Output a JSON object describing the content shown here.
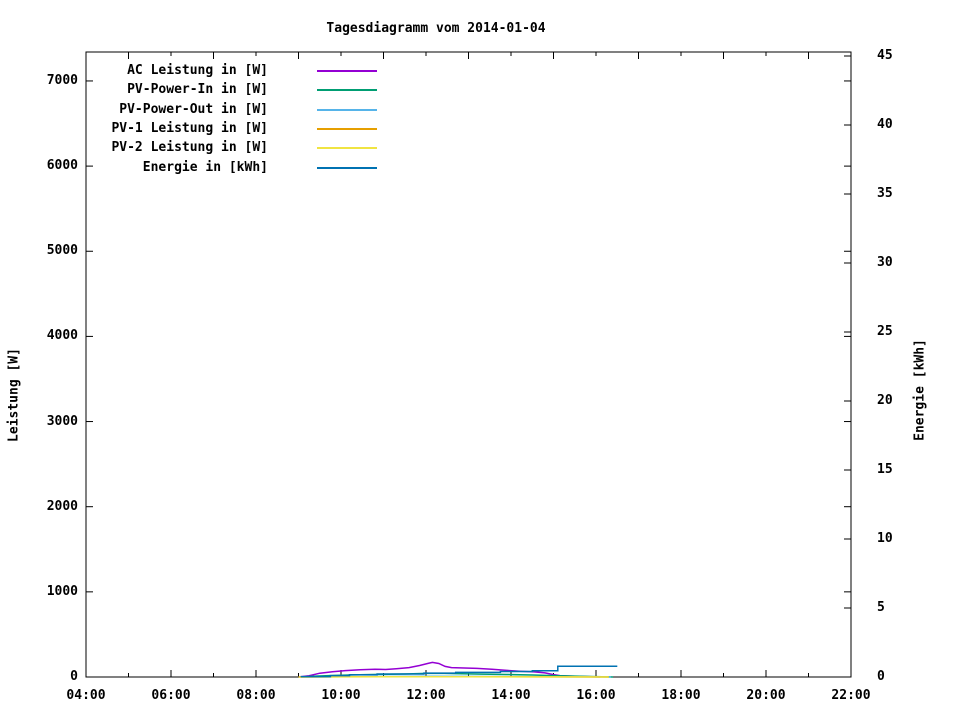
{
  "chart_data": {
    "type": "line",
    "title": "Tagesdiagramm vom 2014-01-04",
    "xlabel": "",
    "x_axis": {
      "range_hours": [
        4,
        22
      ],
      "major_tick_hours": [
        4,
        6,
        8,
        10,
        12,
        14,
        16,
        18,
        20,
        22
      ],
      "minor_tick_hours": [
        5,
        7,
        9,
        11,
        13,
        15,
        17,
        19,
        21
      ],
      "tick_labels": [
        "04:00",
        "06:00",
        "08:00",
        "10:00",
        "12:00",
        "14:00",
        "16:00",
        "18:00",
        "20:00",
        "22:00"
      ]
    },
    "y_left": {
      "label": "Leistung [W]",
      "range": [
        0,
        7340
      ],
      "ticks": [
        0,
        1000,
        2000,
        3000,
        4000,
        5000,
        6000,
        7000
      ]
    },
    "y_right": {
      "label": "Energie [kWh]",
      "range": [
        0,
        45.3
      ],
      "ticks": [
        0,
        5,
        10,
        15,
        20,
        25,
        30,
        35,
        40,
        45
      ]
    },
    "grid": "off",
    "legend_position": "top-left-inside",
    "series": [
      {
        "name": "AC Leistung in [W]",
        "color": "#9400d3",
        "axis": "left",
        "step": false,
        "points": [
          [
            9.0,
            0
          ],
          [
            9.25,
            15
          ],
          [
            9.5,
            45
          ],
          [
            9.8,
            62
          ],
          [
            10.1,
            75
          ],
          [
            10.45,
            85
          ],
          [
            10.8,
            92
          ],
          [
            11.05,
            88
          ],
          [
            11.3,
            97
          ],
          [
            11.6,
            110
          ],
          [
            11.85,
            135
          ],
          [
            12.05,
            160
          ],
          [
            12.15,
            172
          ],
          [
            12.3,
            158
          ],
          [
            12.45,
            125
          ],
          [
            12.6,
            110
          ],
          [
            12.9,
            106
          ],
          [
            13.2,
            101
          ],
          [
            13.55,
            92
          ],
          [
            13.9,
            78
          ],
          [
            14.2,
            68
          ],
          [
            14.55,
            60
          ],
          [
            14.8,
            48
          ],
          [
            15.0,
            28
          ],
          [
            15.15,
            16
          ],
          [
            15.4,
            10
          ],
          [
            15.7,
            6
          ],
          [
            16.1,
            0
          ]
        ]
      },
      {
        "name": "PV-Power-In in [W]",
        "color": "#009e73",
        "axis": "left",
        "step": false,
        "points": [
          [
            9.05,
            0
          ],
          [
            9.4,
            10
          ],
          [
            9.8,
            18
          ],
          [
            10.3,
            25
          ],
          [
            10.9,
            30
          ],
          [
            11.5,
            35
          ],
          [
            12.0,
            42
          ],
          [
            12.3,
            45
          ],
          [
            12.7,
            40
          ],
          [
            13.3,
            34
          ],
          [
            13.9,
            29
          ],
          [
            14.5,
            24
          ],
          [
            15.0,
            17
          ],
          [
            15.5,
            10
          ],
          [
            16.0,
            5
          ],
          [
            16.4,
            0
          ]
        ]
      },
      {
        "name": "PV-Power-Out in [W]",
        "color": "#56b4e9",
        "axis": "left",
        "step": false,
        "points": [
          [
            9.1,
            0
          ],
          [
            9.8,
            3
          ],
          [
            10.5,
            5
          ],
          [
            11.5,
            7
          ],
          [
            12.2,
            9
          ],
          [
            13.0,
            7
          ],
          [
            14.0,
            5
          ],
          [
            15.0,
            3
          ],
          [
            15.8,
            1
          ],
          [
            16.35,
            0
          ]
        ]
      },
      {
        "name": "PV-1 Leistung in [W]",
        "color": "#e69f00",
        "axis": "left",
        "step": false,
        "points": [
          [
            9.0,
            0
          ],
          [
            10.0,
            2
          ],
          [
            11.0,
            3
          ],
          [
            12.0,
            4
          ],
          [
            13.0,
            3
          ],
          [
            14.0,
            2
          ],
          [
            15.0,
            1
          ],
          [
            16.3,
            0
          ]
        ]
      },
      {
        "name": "PV-2 Leistung in [W]",
        "color": "#f0e442",
        "axis": "left",
        "step": false,
        "points": [
          [
            9.0,
            0
          ],
          [
            10.0,
            1
          ],
          [
            11.0,
            2
          ],
          [
            12.0,
            2
          ],
          [
            13.0,
            2
          ],
          [
            14.0,
            1
          ],
          [
            15.0,
            1
          ],
          [
            16.3,
            0
          ]
        ]
      },
      {
        "name": "Energie in [kWh]",
        "color": "#0072b2",
        "axis": "right",
        "step": true,
        "points": [
          [
            9.05,
            0.03
          ],
          [
            9.75,
            0.1
          ],
          [
            10.2,
            0.17
          ],
          [
            10.85,
            0.22
          ],
          [
            11.95,
            0.28
          ],
          [
            12.7,
            0.33
          ],
          [
            13.75,
            0.4
          ],
          [
            14.5,
            0.45
          ],
          [
            15.1,
            0.78
          ],
          [
            16.5,
            0.78
          ]
        ]
      }
    ]
  }
}
